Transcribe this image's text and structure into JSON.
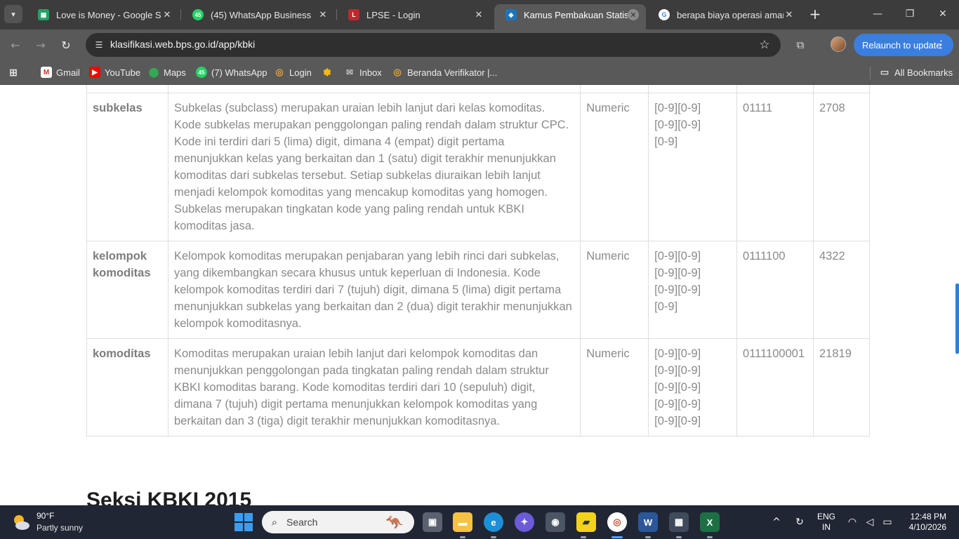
{
  "browser": {
    "tabs": [
      {
        "title": "Love is Money - Google Spre",
        "favicon": "google-sheets-icon",
        "color": "#1fa463",
        "glyph": "▦"
      },
      {
        "title": "(45) WhatsApp Business",
        "favicon": "whatsapp-icon",
        "color": "#25d366",
        "glyph": "45"
      },
      {
        "title": "LPSE - Login",
        "favicon": "lpse-icon",
        "color": "#c0272d",
        "glyph": "L"
      },
      {
        "title": "Kamus Pembakuan Statistik",
        "favicon": "bps-icon",
        "color": "#1b75bb",
        "glyph": "◆"
      },
      {
        "title": "berapa biaya operasi amand",
        "favicon": "google-icon",
        "color": "#ffffff",
        "glyph": "G"
      }
    ],
    "url": "klasifikasi.web.bps.go.id/app/kbki",
    "relaunch_label": "Relaunch to update",
    "bookmarks": [
      {
        "label": "Gmail",
        "icon": "gmail-icon"
      },
      {
        "label": "YouTube",
        "icon": "youtube-icon"
      },
      {
        "label": "Maps",
        "icon": "maps-icon"
      },
      {
        "label": "(7) WhatsApp",
        "icon": "whatsapp-icon",
        "badge": "45"
      },
      {
        "label": "Login",
        "icon": "login-icon"
      },
      {
        "label": "",
        "icon": "photos-icon"
      },
      {
        "label": "Inbox",
        "icon": "inbox-icon"
      },
      {
        "label": "Beranda Verifikator |...",
        "icon": "verifikator-icon"
      }
    ],
    "all_bookmarks": "All Bookmarks"
  },
  "table": {
    "rows": [
      {
        "name": "subkelas",
        "description": "Subkelas (subclass) merupakan uraian lebih lanjut dari kelas komoditas. Kode subkelas merupakan penggolongan paling rendah dalam struktur CPC. Kode ini terdiri dari 5 (lima) digit, dimana 4 (empat) digit pertama menunjukkan kelas yang berkaitan dan 1 (satu) digit terakhir menunjukkan komoditas dari subkelas tersebut. Setiap subkelas diuraikan lebih lanjut menjadi kelompok komoditas yang mencakup komoditas yang homogen. Subkelas merupakan tingkatan kode yang paling rendah untuk KBKI komoditas jasa.",
        "type": "Numeric",
        "pattern": "[0-9][0-9][0-9][0-9][0-9]",
        "example": "01111",
        "count": "2708"
      },
      {
        "name": "kelompok komoditas",
        "description": "Kelompok komoditas merupakan penjabaran yang lebih rinci dari subkelas, yang dikembangkan secara khusus untuk keperluan di Indonesia. Kode kelompok komoditas terdiri dari 7 (tujuh) digit, dimana 5 (lima) digit pertama menunjukkan subkelas yang berkaitan dan 2 (dua) digit terakhir menunjukkan kelompok komoditasnya.",
        "type": "Numeric",
        "pattern": "[0-9][0-9][0-9][0-9][0-9][0-9][0-9]",
        "example": "0111100",
        "count": "4322"
      },
      {
        "name": "komoditas",
        "description": "Komoditas merupakan uraian lebih lanjut dari kelompok komoditas dan menunjukkan penggolongan pada tingkatan paling rendah dalam struktur KBKI komoditas barang. Kode komoditas terdiri dari 10 (sepuluh) digit, dimana 7 (tujuh) digit pertama menunjukkan kelompok komoditas yang berkaitan dan 3 (tiga) digit terakhir menunjukkan komoditasnya.",
        "type": "Numeric",
        "pattern": "[0-9][0-9][0-9][0-9][0-9][0-9][0-9][0-9][0-9][0-9]",
        "example": "0111100001",
        "count": "21819"
      }
    ]
  },
  "section_heading": "Seksi KBKI 2015",
  "taskbar": {
    "weather_temp": "90°F",
    "weather_desc": "Partly sunny",
    "search_placeholder": "Search",
    "lang_line1": "ENG",
    "lang_line2": "IN",
    "time": "12:48 PM",
    "date": "4/10/2026"
  }
}
